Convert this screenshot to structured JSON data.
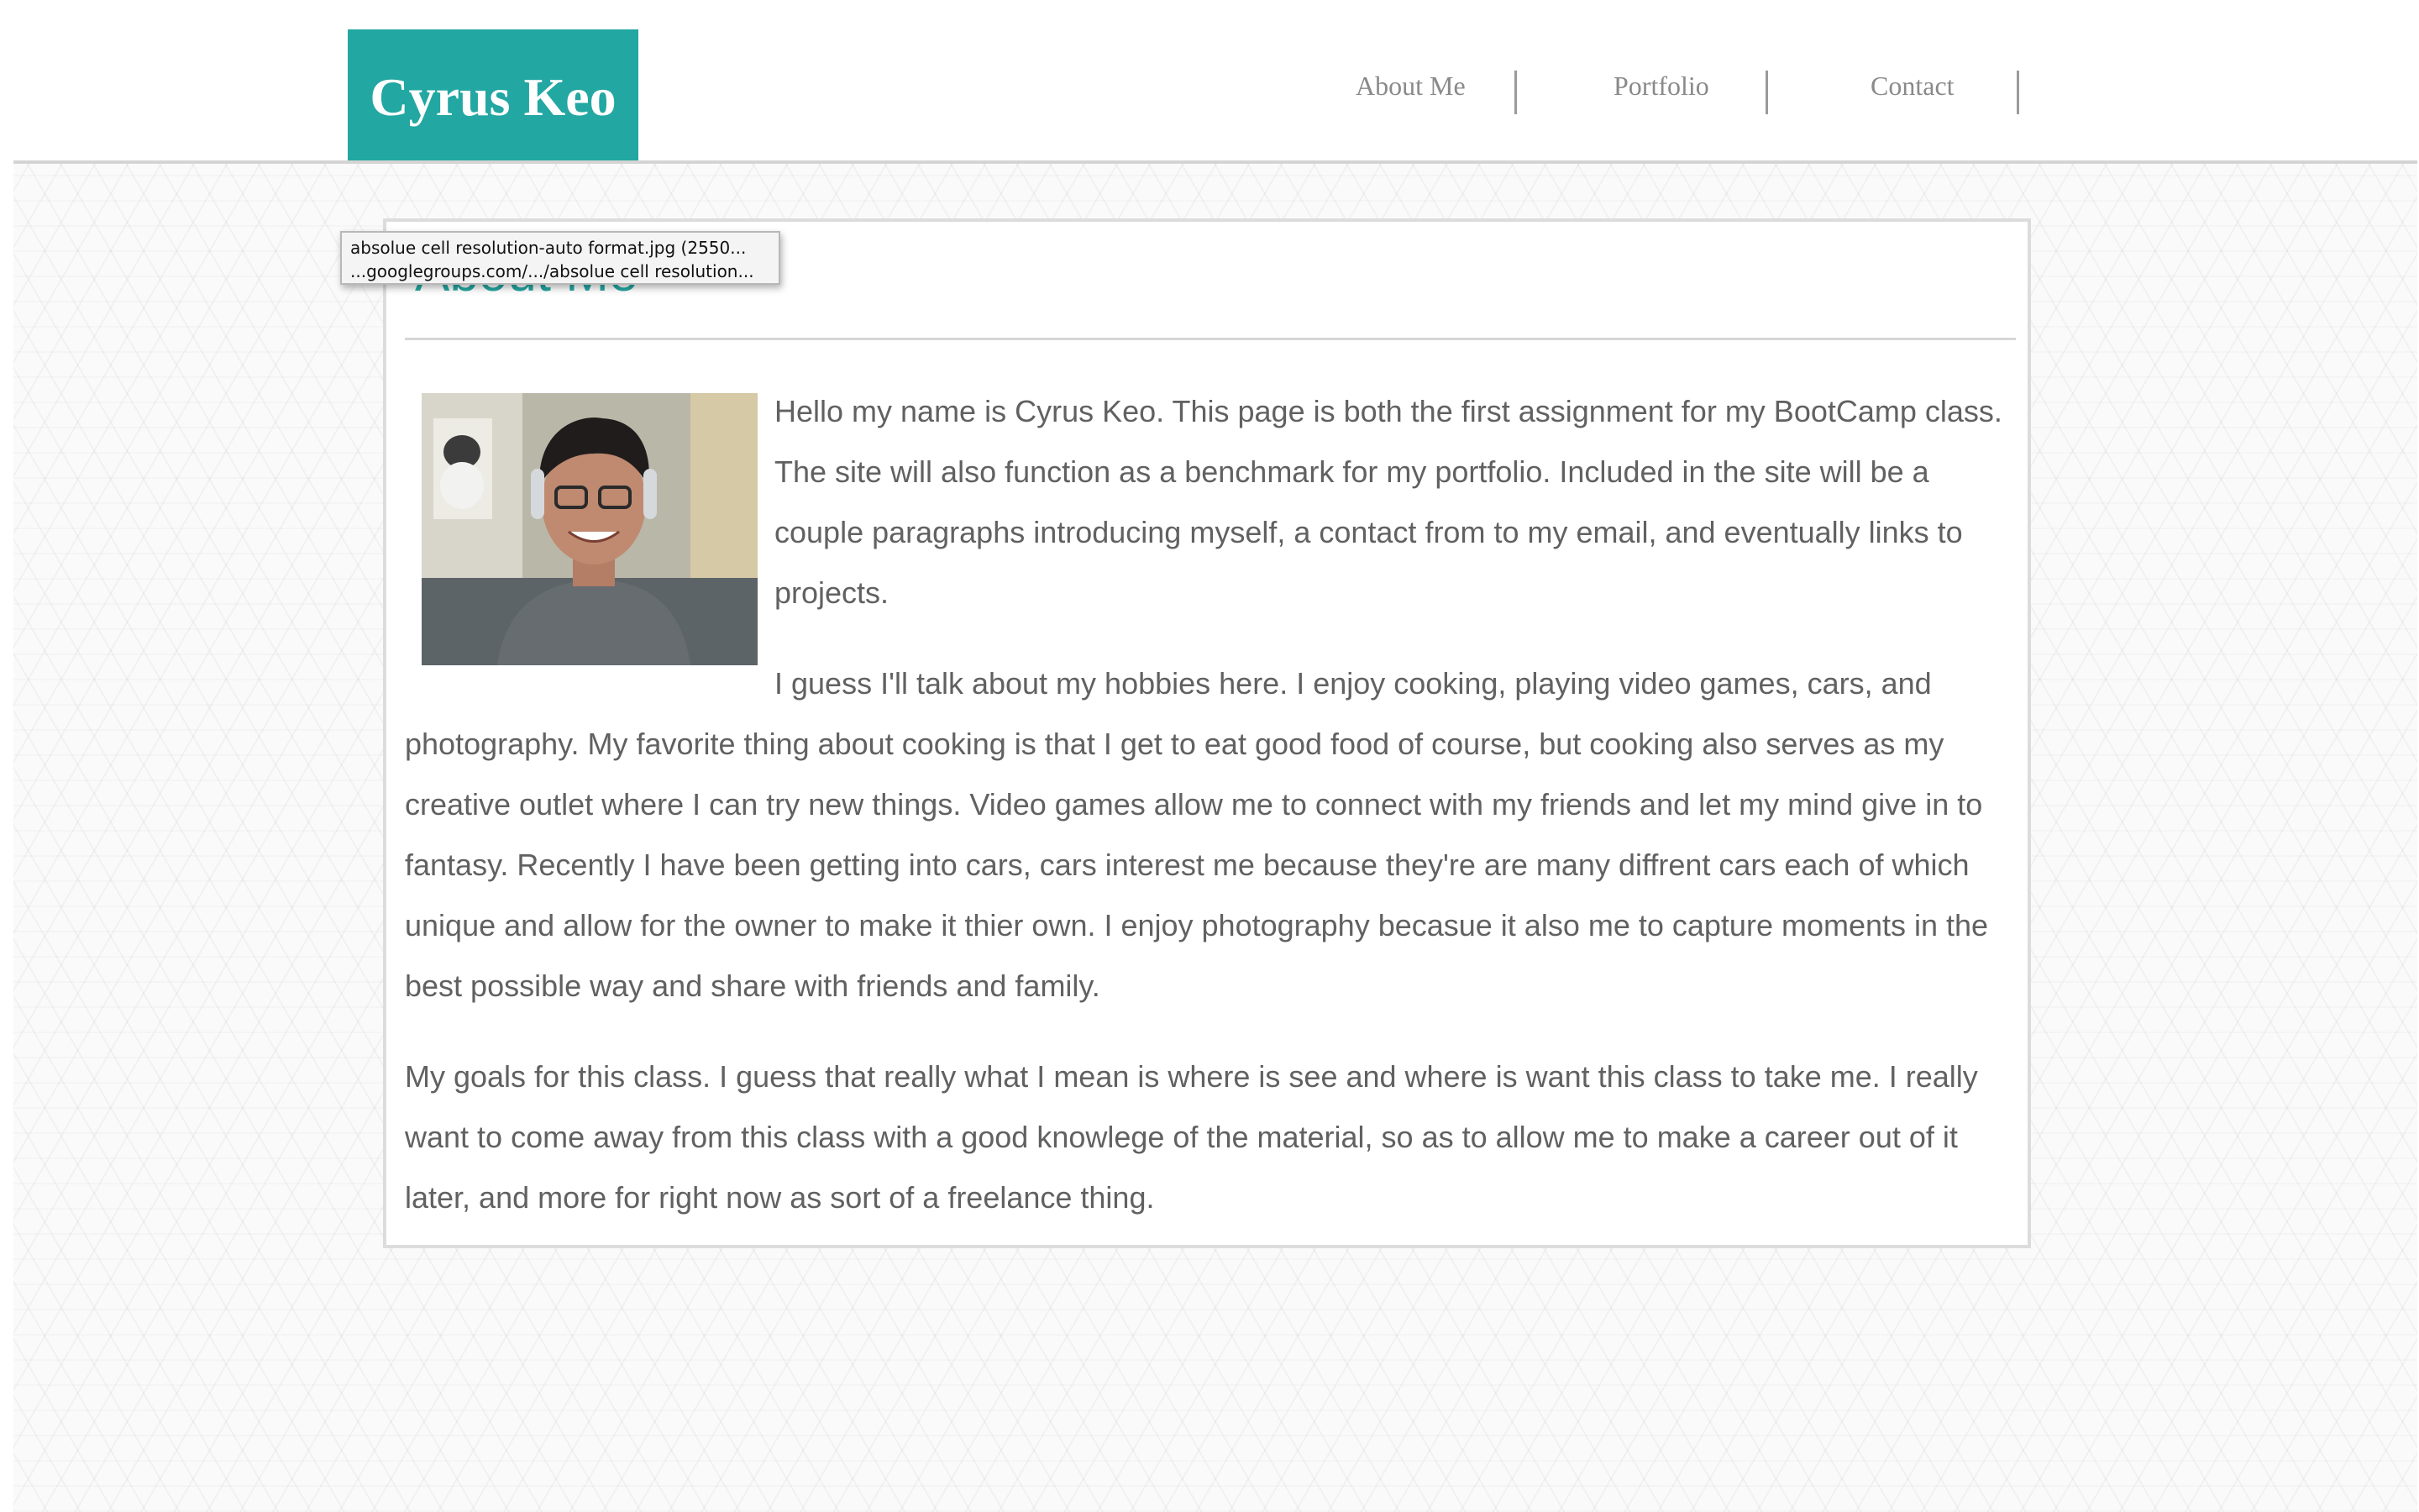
{
  "header": {
    "logo_text": "Cyrus Keo",
    "nav": [
      {
        "label": "About Me"
      },
      {
        "label": "Portfolio"
      },
      {
        "label": "Contact"
      }
    ]
  },
  "colors": {
    "accent": "#23a7a2",
    "text": "#616161",
    "nav_text": "#8a8a8a"
  },
  "main": {
    "title": "About Me",
    "paragraphs": [
      "Hello my name is Cyrus Keo. This page is both the first assignment for my BootCamp class. The site will also function as a benchmark for my portfolio. Included in the site will be a couple paragraphs introducing myself, a contact from to my email, and eventually links to projects.",
      "I guess I'll talk about my hobbies here. I enjoy cooking, playing video games, cars, and photography. My favorite thing about cooking is that I get to eat good food of course, but cooking also serves as my creative outlet where I can try new things. Video games allow me to connect with my friends and let my mind give in to fantasy. Recently I have been getting into cars, cars interest me because they're are many diffrent cars each of which unique and allow for the owner to make it thier own. I enjoy photography becasue it also me to capture moments in the best possible way and share with friends and family.",
      "My goals for this class. I guess that really what I mean is where is see and where is want this class to take me. I really want to come away from this class with a good knowlege of the material, so as to allow me to make a career out of it later, and more for right now as sort of a freelance thing."
    ]
  },
  "tooltip": {
    "line1": "absolue cell resolution-auto format.jpg (2550...",
    "line2": "...googlegroups.com/.../absolue cell resolution..."
  }
}
